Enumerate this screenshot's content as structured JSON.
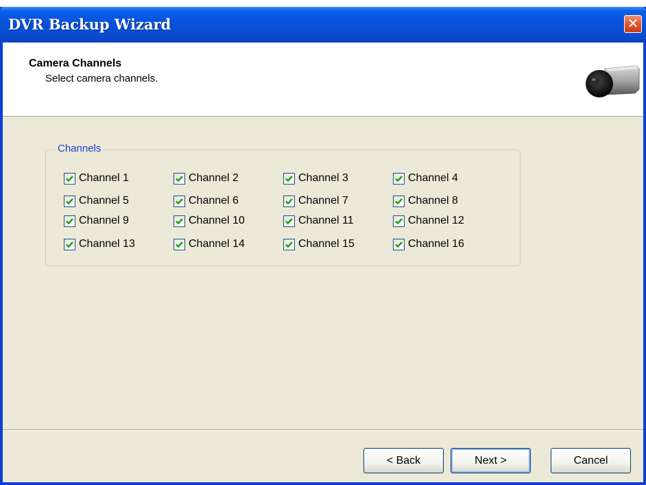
{
  "window": {
    "title": "DVR Backup Wizard"
  },
  "header": {
    "title": "Camera Channels",
    "subtitle": "Select camera channels."
  },
  "group": {
    "label": "Channels"
  },
  "channels": [
    {
      "label": "Channel 1",
      "checked": true
    },
    {
      "label": "Channel 2",
      "checked": true
    },
    {
      "label": "Channel 3",
      "checked": true
    },
    {
      "label": "Channel 4",
      "checked": true
    },
    {
      "label": "Channel 5",
      "checked": true
    },
    {
      "label": "Channel 6",
      "checked": true
    },
    {
      "label": "Channel 7",
      "checked": true
    },
    {
      "label": "Channel 8",
      "checked": true
    },
    {
      "label": "Channel 9",
      "checked": true
    },
    {
      "label": "Channel 10",
      "checked": true
    },
    {
      "label": "Channel 11",
      "checked": true
    },
    {
      "label": "Channel 12",
      "checked": true
    },
    {
      "label": "Channel 13",
      "checked": true
    },
    {
      "label": "Channel 14",
      "checked": true
    },
    {
      "label": "Channel 15",
      "checked": true
    },
    {
      "label": "Channel 16",
      "checked": true
    }
  ],
  "buttons": {
    "back": "< Back",
    "next": "Next >",
    "cancel": "Cancel"
  },
  "icons": {
    "close": "close-icon",
    "camera": "camera-icon",
    "check": "checkmark-icon"
  },
  "colors": {
    "titlebar": "#0852db",
    "accent_label": "#1e3cce",
    "checkmark": "#1a9e1a"
  }
}
